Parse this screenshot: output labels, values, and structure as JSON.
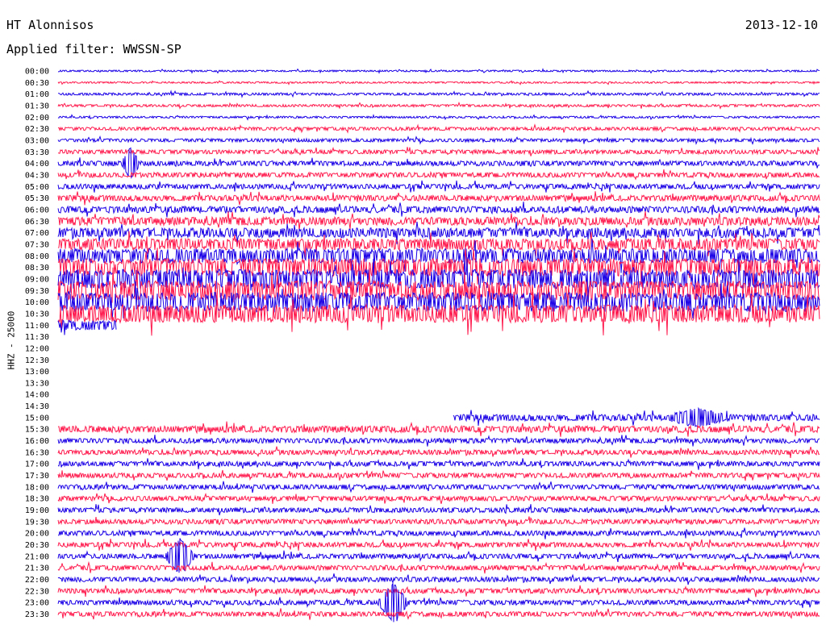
{
  "header": {
    "station": "HT Alonnisos",
    "date": "2013-12-10",
    "filter": "Applied filter: WWSSN-SP"
  },
  "chart_data": {
    "type": "line",
    "title": "HT Alonnisos",
    "channel_label": "HHZ - 25000",
    "colors": [
      "#1a00e6",
      "#ff1a4d"
    ],
    "rows": [
      {
        "label": "00:00",
        "color": 0,
        "amp": 1
      },
      {
        "label": "00:30",
        "color": 1,
        "amp": 1
      },
      {
        "label": "01:00",
        "color": 0,
        "amp": 1.5
      },
      {
        "label": "01:30",
        "color": 1,
        "amp": 1.5
      },
      {
        "label": "02:00",
        "color": 0,
        "amp": 1.2
      },
      {
        "label": "02:30",
        "color": 1,
        "amp": 2
      },
      {
        "label": "03:00",
        "color": 0,
        "amp": 2
      },
      {
        "label": "03:30",
        "color": 1,
        "amp": 2.5
      },
      {
        "label": "04:00",
        "color": 0,
        "amp": 3
      },
      {
        "label": "04:30",
        "color": 1,
        "amp": 3
      },
      {
        "label": "05:00",
        "color": 0,
        "amp": 3
      },
      {
        "label": "05:30",
        "color": 1,
        "amp": 3.5
      },
      {
        "label": "06:00",
        "color": 0,
        "amp": 4
      },
      {
        "label": "06:30",
        "color": 1,
        "amp": 5
      },
      {
        "label": "07:00",
        "color": 0,
        "amp": 6
      },
      {
        "label": "07:30",
        "color": 1,
        "amp": 7
      },
      {
        "label": "08:00",
        "color": 0,
        "amp": 9
      },
      {
        "label": "08:30",
        "color": 1,
        "amp": 11
      },
      {
        "label": "09:00",
        "color": 0,
        "amp": 12
      },
      {
        "label": "09:30",
        "color": 1,
        "amp": 12
      },
      {
        "label": "10:00",
        "color": 0,
        "amp": 12
      },
      {
        "label": "10:30",
        "color": 1,
        "amp": 11
      },
      {
        "label": "11:00",
        "color": 0,
        "amp": 6
      },
      {
        "label": "11:30",
        "color": 1,
        "amp": 0
      },
      {
        "label": "12:00",
        "color": 0,
        "amp": 0
      },
      {
        "label": "12:30",
        "color": 1,
        "amp": 0
      },
      {
        "label": "13:00",
        "color": 0,
        "amp": 0
      },
      {
        "label": "13:30",
        "color": 1,
        "amp": 0
      },
      {
        "label": "14:00",
        "color": 0,
        "amp": 0
      },
      {
        "label": "14:30",
        "color": 1,
        "amp": 0
      },
      {
        "label": "15:00",
        "color": 0,
        "amp": 4
      },
      {
        "label": "15:30",
        "color": 1,
        "amp": 4
      },
      {
        "label": "16:00",
        "color": 0,
        "amp": 3
      },
      {
        "label": "16:30",
        "color": 1,
        "amp": 3
      },
      {
        "label": "17:00",
        "color": 0,
        "amp": 3
      },
      {
        "label": "17:30",
        "color": 1,
        "amp": 3
      },
      {
        "label": "18:00",
        "color": 0,
        "amp": 3
      },
      {
        "label": "18:30",
        "color": 1,
        "amp": 3
      },
      {
        "label": "19:00",
        "color": 0,
        "amp": 3
      },
      {
        "label": "19:30",
        "color": 1,
        "amp": 3
      },
      {
        "label": "20:00",
        "color": 0,
        "amp": 3
      },
      {
        "label": "20:30",
        "color": 1,
        "amp": 3
      },
      {
        "label": "21:00",
        "color": 0,
        "amp": 3
      },
      {
        "label": "21:30",
        "color": 1,
        "amp": 3
      },
      {
        "label": "22:00",
        "color": 0,
        "amp": 3
      },
      {
        "label": "22:30",
        "color": 1,
        "amp": 3
      },
      {
        "label": "23:00",
        "color": 0,
        "amp": 3
      },
      {
        "label": "23:30",
        "color": 1,
        "amp": 3
      }
    ]
  }
}
